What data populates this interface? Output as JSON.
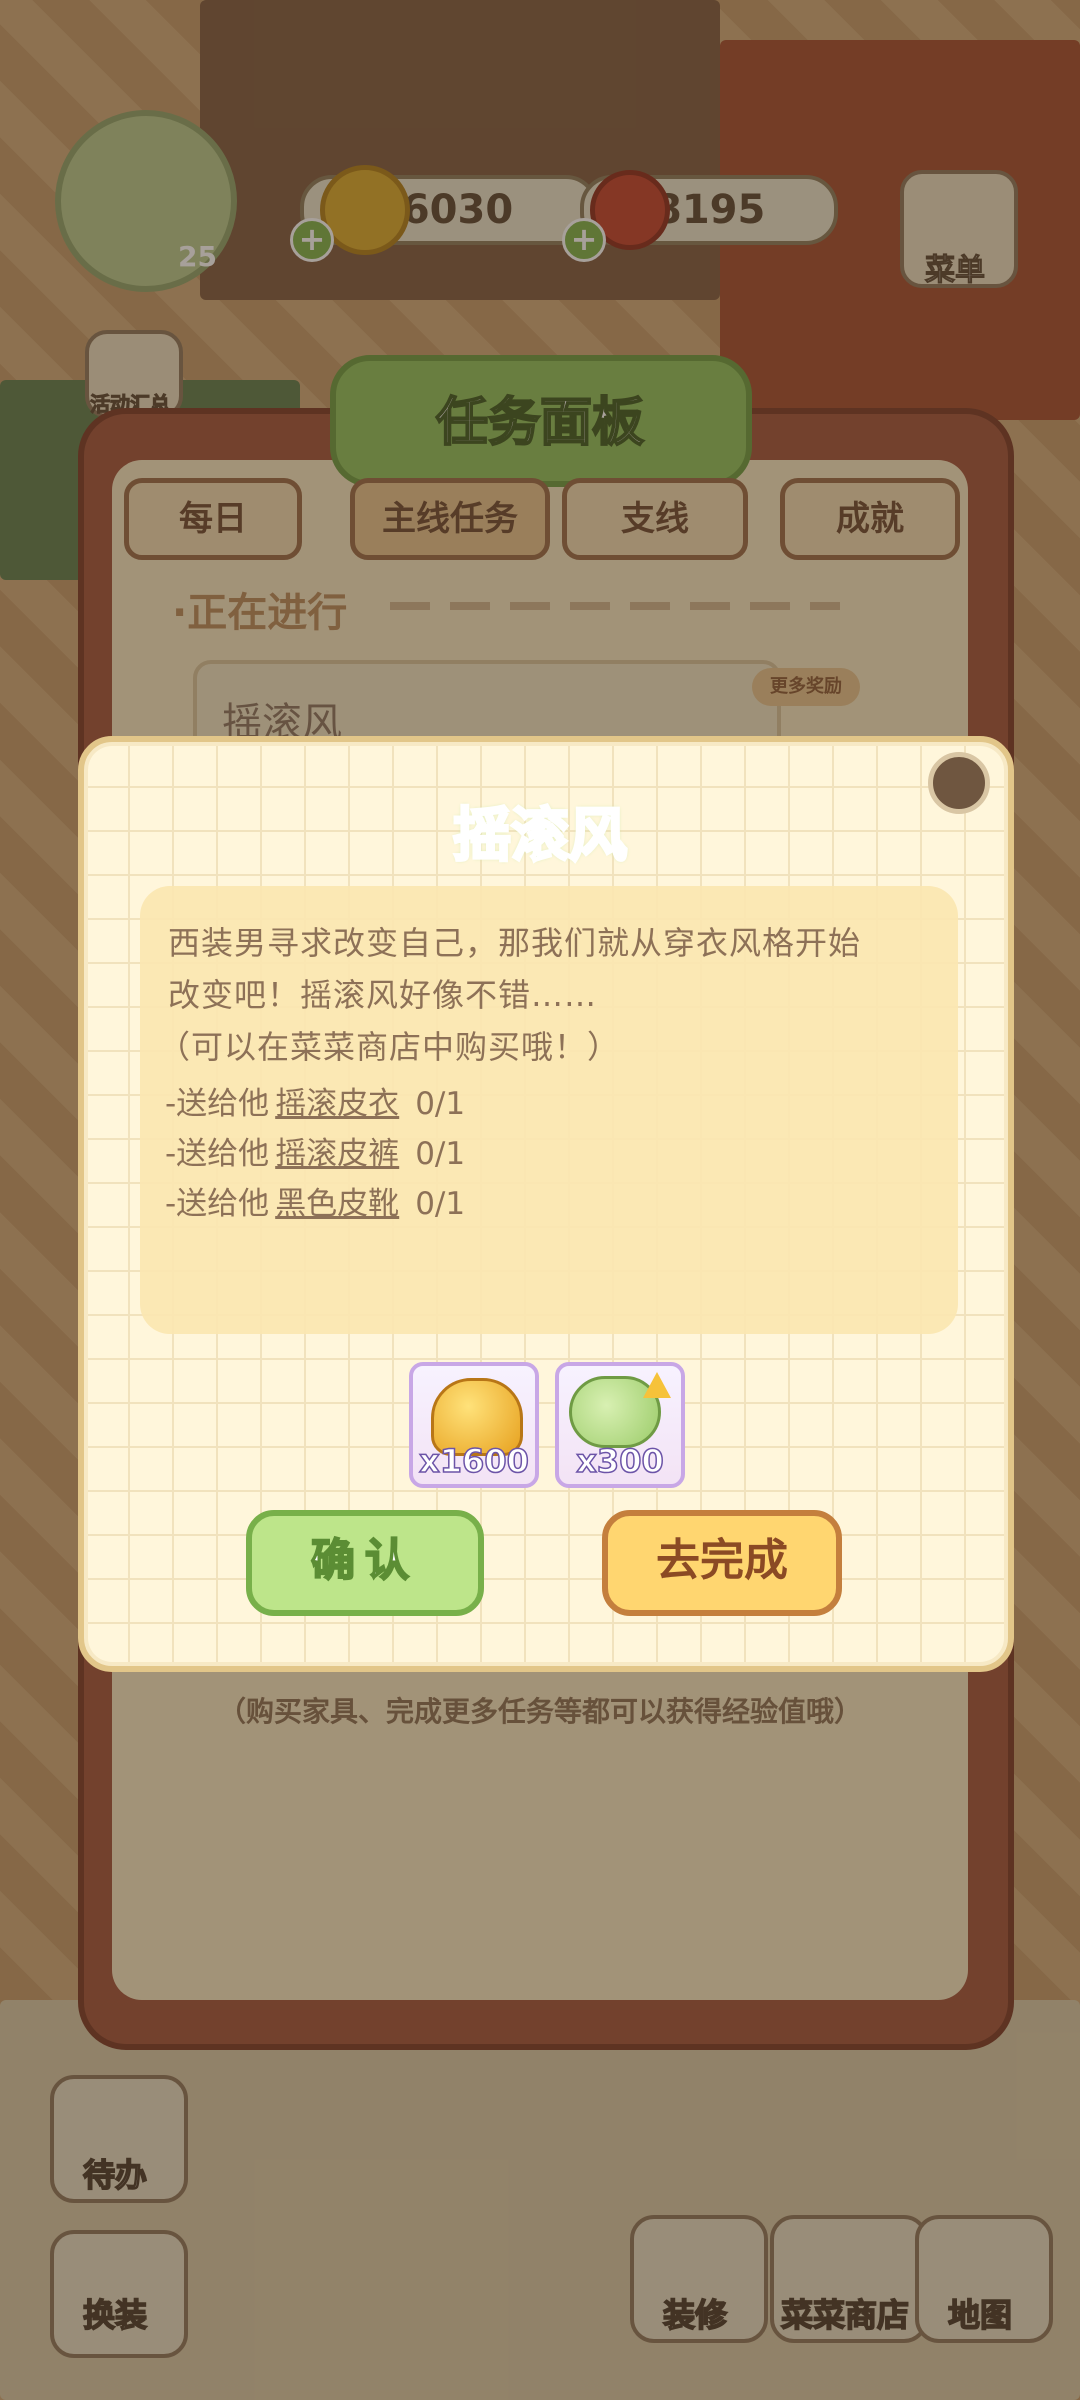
{
  "hud": {
    "level": "25",
    "coins": "96030",
    "meat": "8195",
    "menu_label": "菜单",
    "events_label": "活动汇总"
  },
  "task_panel": {
    "title": "任务面板",
    "tabs": [
      {
        "label": "每日",
        "active": false
      },
      {
        "label": "主线任务",
        "active": true
      },
      {
        "label": "支线",
        "active": false
      },
      {
        "label": "成就",
        "active": false
      }
    ],
    "in_progress_label": "·正在进行",
    "quest_card_title": "摇滚风",
    "more_reward_label": "更多奖励",
    "exp_hint": "（购买家具、完成更多任务等都可以获得经验值哦）"
  },
  "dialog": {
    "title": "摇滚风",
    "description": [
      "西装男寻求改变自己，那我们就从穿衣风格开始",
      "改变吧！摇滚风好像不错……",
      "（可以在菜菜商店中购买哦！）"
    ],
    "requirements": [
      {
        "prefix": "-送给他",
        "item": "摇滚皮衣",
        "progress": "0/1"
      },
      {
        "prefix": "-送给他",
        "item": "摇滚皮裤",
        "progress": "0/1"
      },
      {
        "prefix": "-送给他",
        "item": "黑色皮靴",
        "progress": "0/1"
      }
    ],
    "rewards": [
      {
        "icon": "gold-coins-icon",
        "count": "x1600"
      },
      {
        "icon": "green-exp-icon",
        "count": "x300"
      }
    ],
    "confirm_label": "确认",
    "goto_label": "去完成"
  },
  "bottom_nav": {
    "todo": "待办",
    "dress": "换装",
    "decorate": "装修",
    "shop": "菜菜商店",
    "map": "地图"
  },
  "colors": {
    "title_green": "#a7d86e",
    "confirm_green": "#bde58a",
    "goto_yellow": "#ffd670",
    "panel_brown": "#a0533a"
  }
}
